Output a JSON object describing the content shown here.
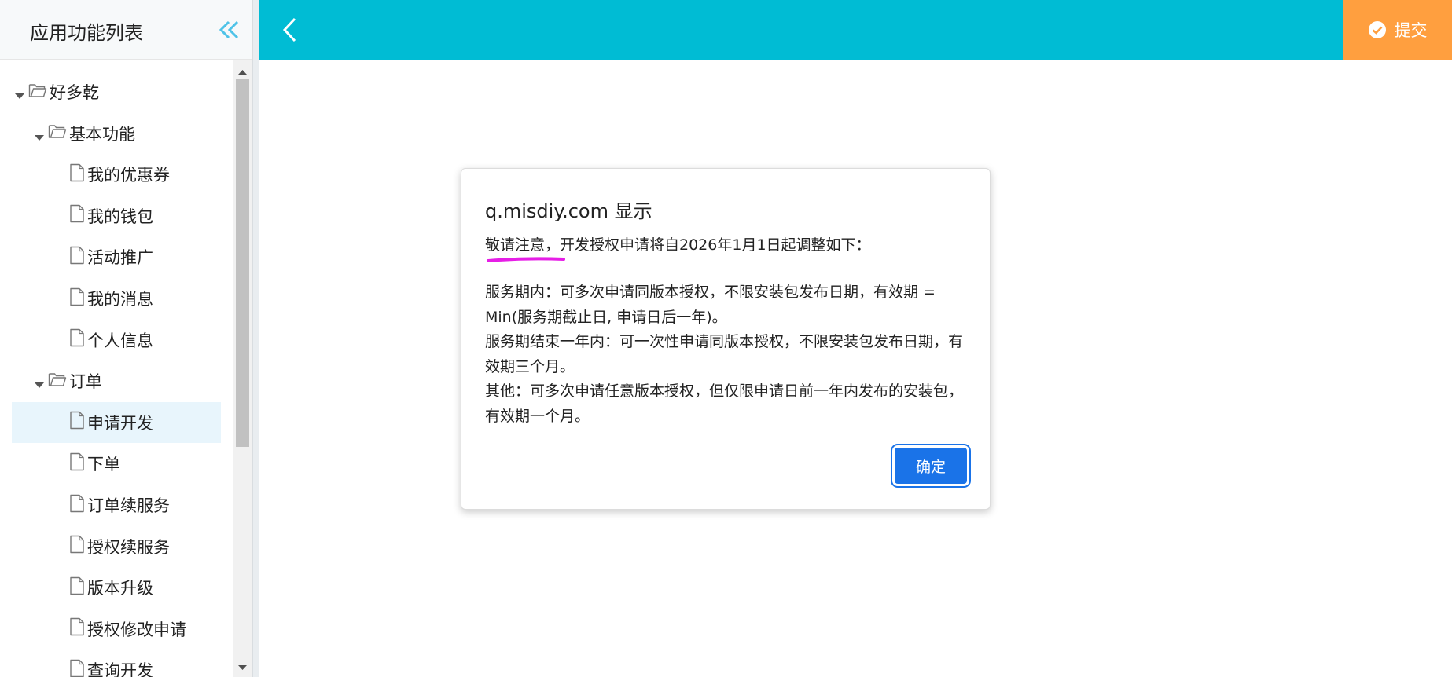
{
  "sidebar": {
    "title": "应用功能列表",
    "tree": [
      {
        "label": "好多乾",
        "type": "folder",
        "level": 0,
        "expanded": true
      },
      {
        "label": "基本功能",
        "type": "folder",
        "level": 1,
        "expanded": true
      },
      {
        "label": "我的优惠券",
        "type": "file",
        "level": 2
      },
      {
        "label": "我的钱包",
        "type": "file",
        "level": 2
      },
      {
        "label": "活动推广",
        "type": "file",
        "level": 2
      },
      {
        "label": "我的消息",
        "type": "file",
        "level": 2
      },
      {
        "label": "个人信息",
        "type": "file",
        "level": 2
      },
      {
        "label": "订单",
        "type": "folder",
        "level": 1,
        "expanded": true
      },
      {
        "label": "申请开发",
        "type": "file",
        "level": 2,
        "selected": true
      },
      {
        "label": "下单",
        "type": "file",
        "level": 2
      },
      {
        "label": "订单续服务",
        "type": "file",
        "level": 2
      },
      {
        "label": "授权续服务",
        "type": "file",
        "level": 2
      },
      {
        "label": "版本升级",
        "type": "file",
        "level": 2
      },
      {
        "label": "授权修改申请",
        "type": "file",
        "level": 2
      },
      {
        "label": "查询开发",
        "type": "file",
        "level": 2
      }
    ]
  },
  "topbar": {
    "color": "#00bcd4",
    "submit_label": "提交",
    "submit_color": "#ff9f3f"
  },
  "dialog": {
    "title": "q.misdiy.com 显示",
    "line1": "敬请注意，开发授权申请将自2026年1月1日起调整如下：",
    "paragraphs": [
      "服务期内：可多次申请同版本授权，不限安装包发布日期，有效期 = Min(服务期截止日, 申请日后一年)。",
      "服务期结束一年内：可一次性申请同版本授权，不限安装包发布日期，有效期三个月。",
      "其他：可多次申请任意版本授权，但仅限申请日前一年内发布的安装包，有效期一个月。"
    ],
    "ok_label": "确定",
    "ok_color": "#1a73e8",
    "annotation_color": "#e61ee6"
  }
}
